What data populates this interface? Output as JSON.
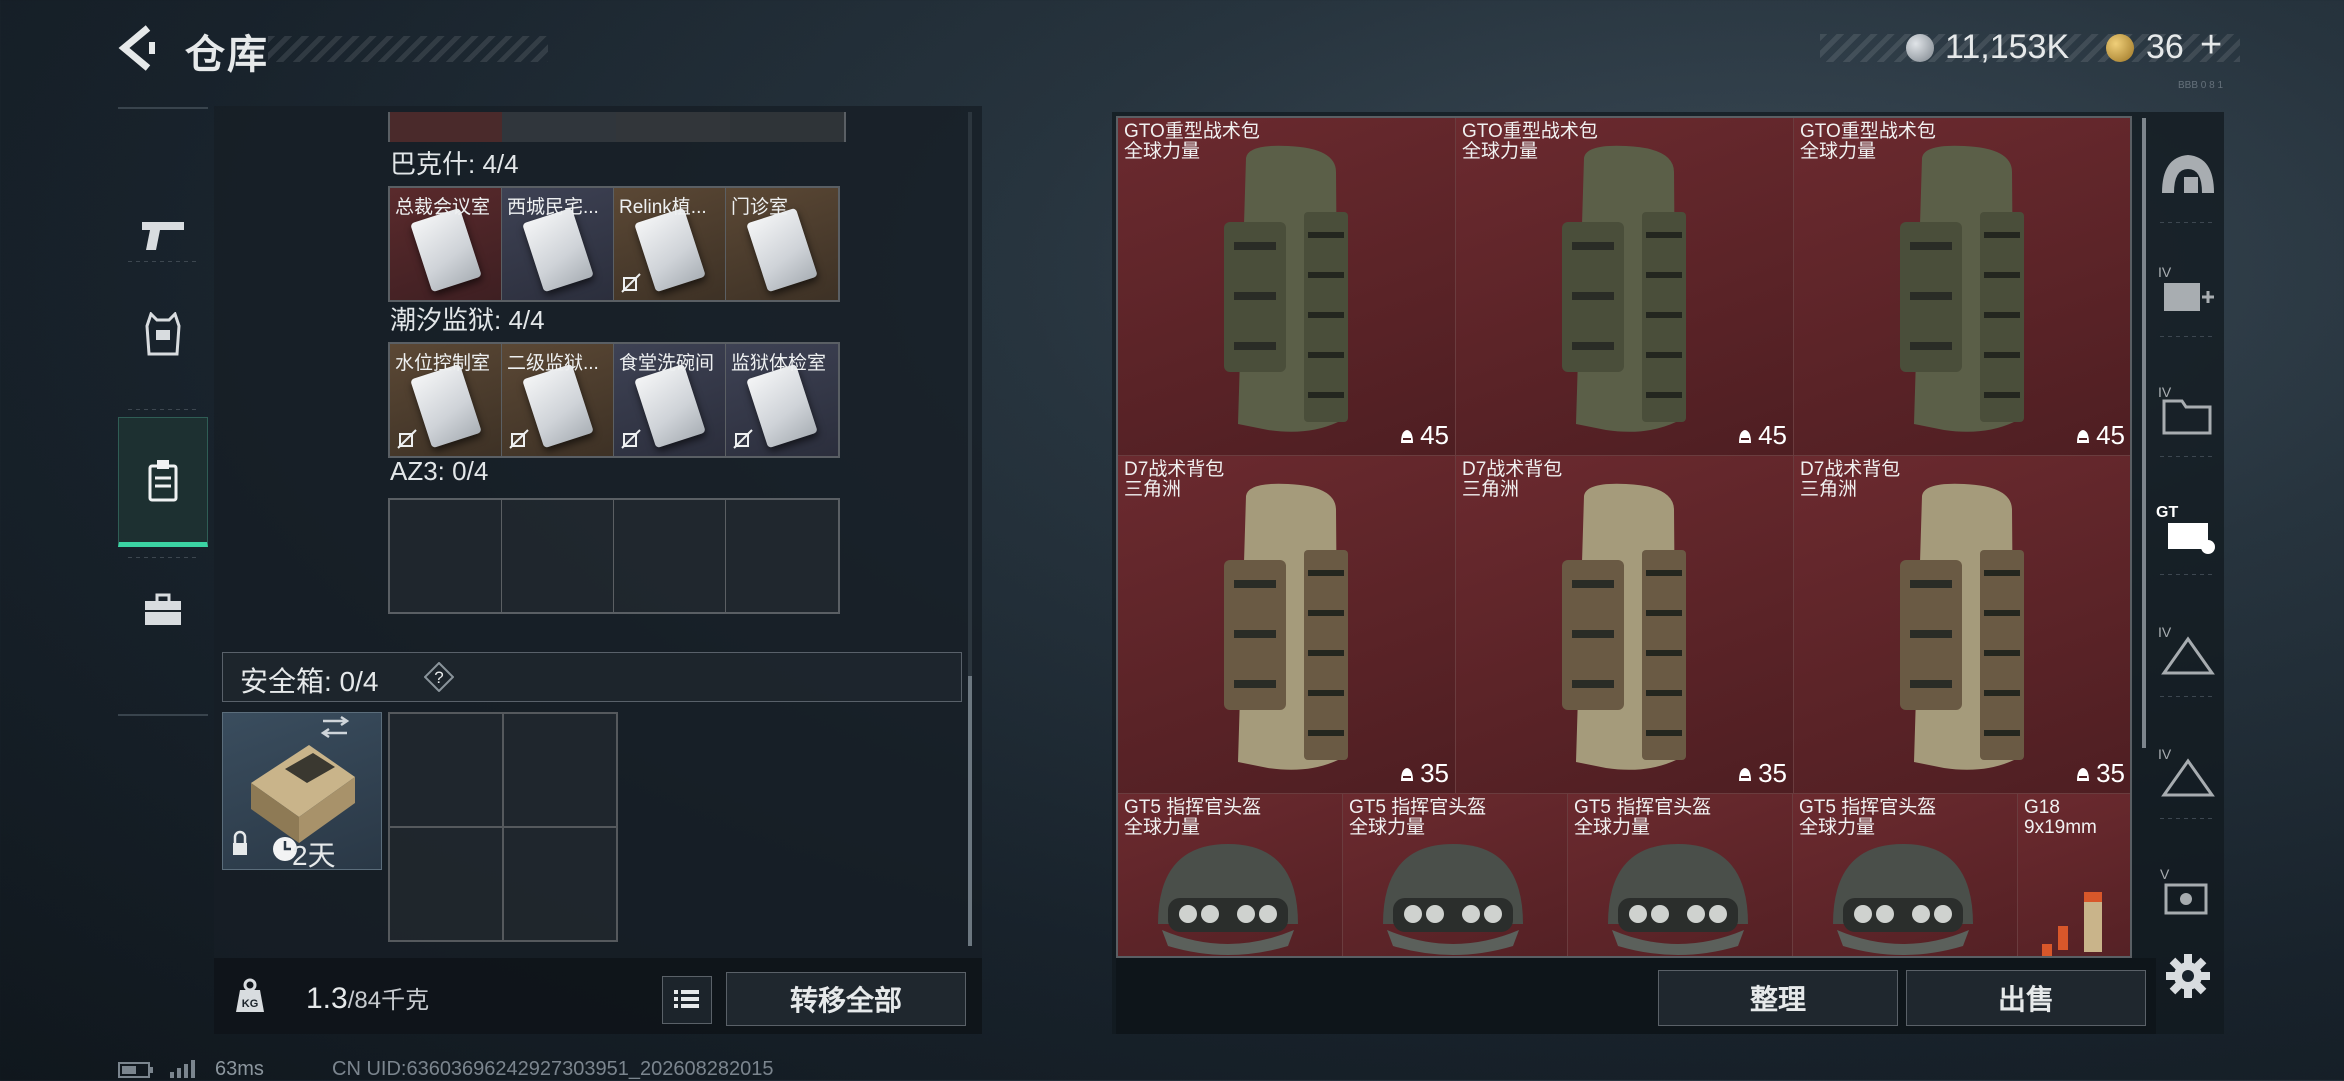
{
  "header": {
    "title": "仓库",
    "currency_silver": "11,153K",
    "currency_gold": "36",
    "gold_plus": "+",
    "version_tag": "BBB 0 8 1"
  },
  "left_nav": {
    "items": [
      {
        "name": "weapons",
        "icon": "pistol-icon"
      },
      {
        "name": "armor",
        "icon": "vest-icon"
      },
      {
        "name": "keys",
        "icon": "keycard-holder-icon",
        "active": true
      },
      {
        "name": "toolbox",
        "icon": "briefcase-icon"
      }
    ]
  },
  "key_groups": [
    {
      "label": "巴克什: 4/4",
      "cells": [
        {
          "name": "总裁会议室",
          "bg": "red"
        },
        {
          "name": "西城民宅...",
          "bg": "blue"
        },
        {
          "name": "Relink植...",
          "bg": "brown",
          "nolink": true
        },
        {
          "name": "门诊室",
          "bg": "brown"
        }
      ]
    },
    {
      "label": "潮汐监狱: 4/4",
      "cells": [
        {
          "name": "水位控制室",
          "bg": "brown",
          "nolink": true
        },
        {
          "name": "二级监狱...",
          "bg": "brown",
          "nolink": true
        },
        {
          "name": "食堂洗碗间",
          "bg": "blue",
          "nolink": true
        },
        {
          "name": "监狱体检室",
          "bg": "blue",
          "nolink": true
        }
      ]
    },
    {
      "label": "AZ3: 0/4",
      "cells": [
        {
          "name": ""
        },
        {
          "name": ""
        },
        {
          "name": ""
        },
        {
          "name": ""
        }
      ]
    }
  ],
  "safe_box": {
    "label": "安全箱: 0/4",
    "help": "?",
    "duration": "2天"
  },
  "weight": {
    "current": "1.3",
    "max": "/84千克",
    "transfer_label": "转移全部"
  },
  "inventory": {
    "backpacks_gto": [
      {
        "name": "GTO重型战术包",
        "sub": "全球力量",
        "durability": "45"
      },
      {
        "name": "GTO重型战术包",
        "sub": "全球力量",
        "durability": "45"
      },
      {
        "name": "GTO重型战术包",
        "sub": "全球力量",
        "durability": "45"
      }
    ],
    "backpacks_d7": [
      {
        "name": "D7战术背包",
        "sub": "三角洲",
        "durability": "35"
      },
      {
        "name": "D7战术背包",
        "sub": "三角洲",
        "durability": "35"
      },
      {
        "name": "D7战术背包",
        "sub": "三角洲",
        "durability": "35"
      }
    ],
    "helmets": [
      {
        "name": "GT5 指挥官头盔",
        "sub": "全球力量"
      },
      {
        "name": "GT5 指挥官头盔",
        "sub": "全球力量"
      },
      {
        "name": "GT5 指挥官头盔",
        "sub": "全球力量"
      },
      {
        "name": "GT5 指挥官头盔",
        "sub": "全球力量"
      }
    ],
    "ammo": {
      "name": "G18",
      "sub": "9x19mm"
    }
  },
  "actions": {
    "sort_label": "整理",
    "sell_label": "出售"
  },
  "right_nav": {
    "items": [
      "helmet-slot-icon",
      "add-item-iv-icon",
      "folder-iv-icon",
      "gto-backpack-icon",
      "triangle-iv-icon",
      "triangle-iv-icon-2",
      "map-v-icon"
    ]
  },
  "footer": {
    "ping": "63ms",
    "uid": "CN UID:63603696242927303951_202608282015"
  },
  "colors": {
    "accent_green": "#3bd3a3",
    "item_bg_red": "#5a2327"
  }
}
